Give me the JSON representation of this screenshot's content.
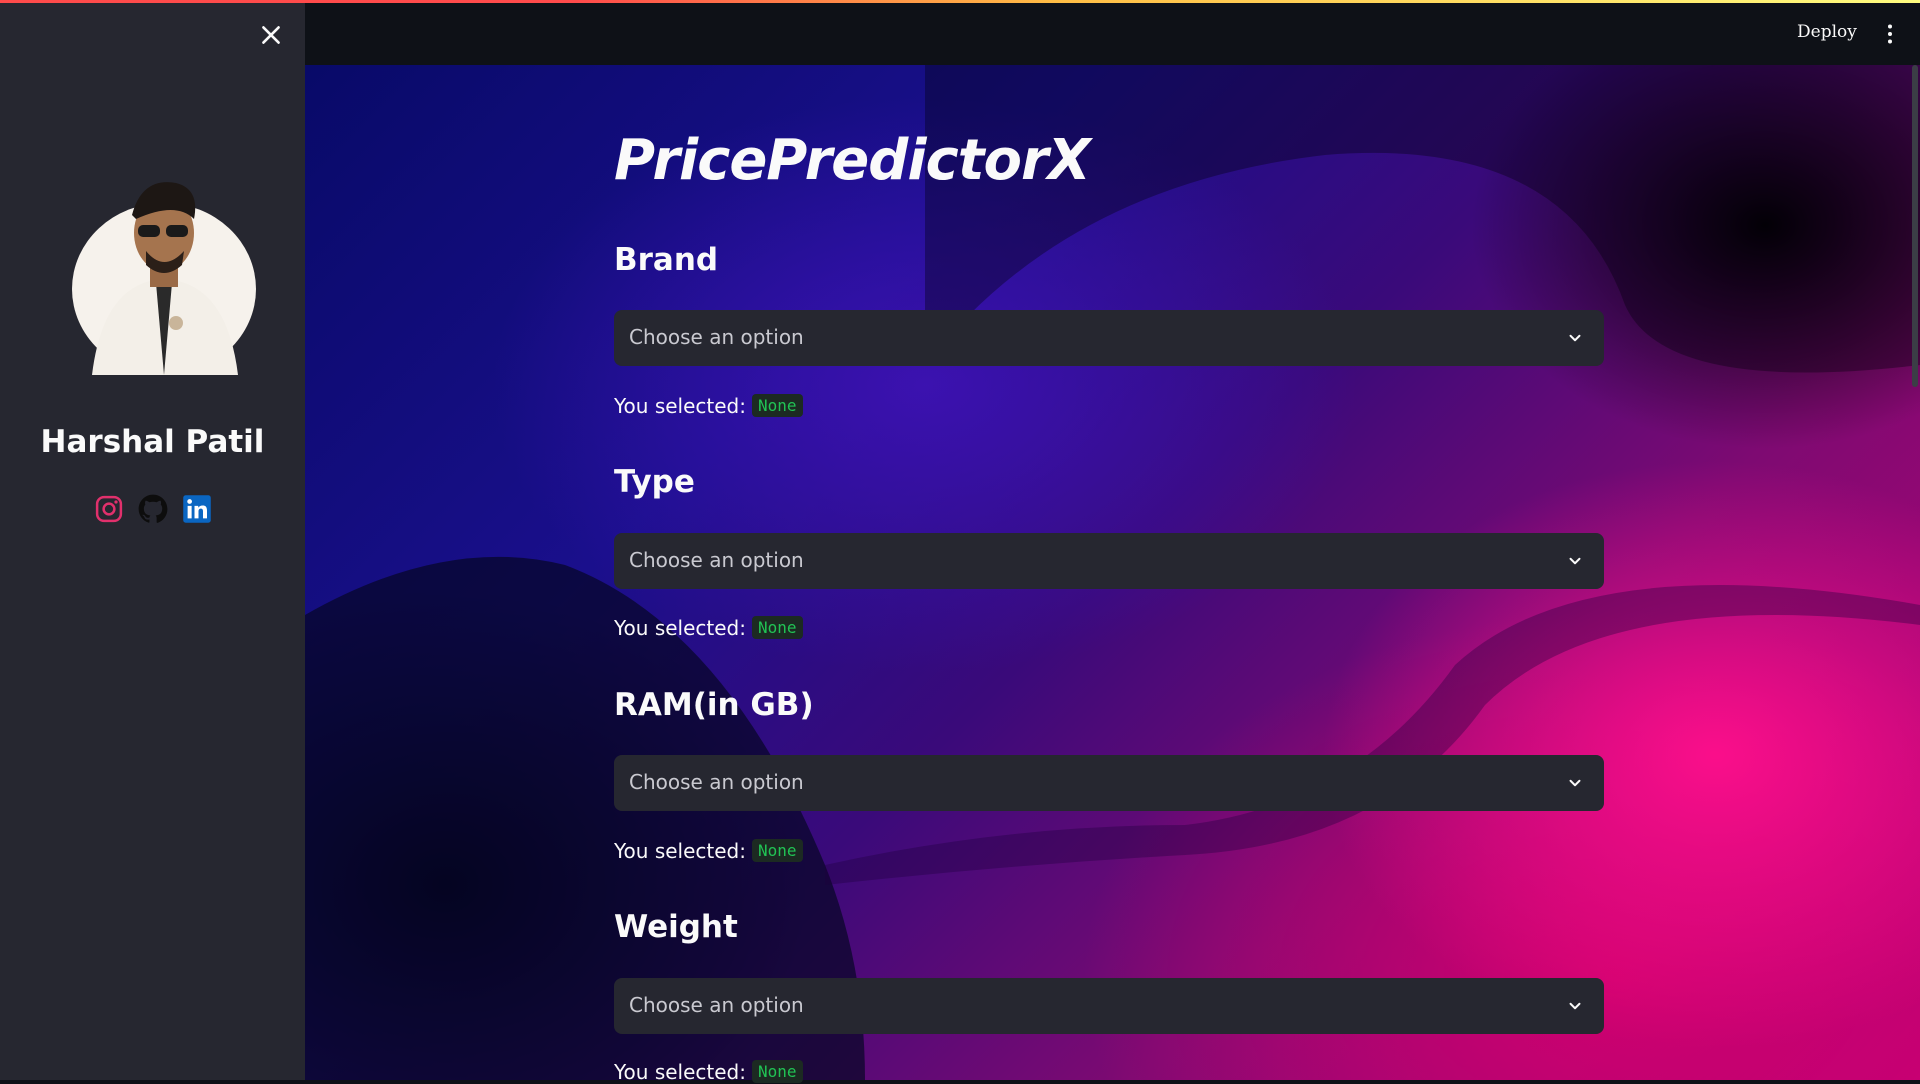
{
  "sidebar": {
    "name": "Harshal Patil",
    "social_icons": [
      "instagram-icon",
      "github-icon",
      "linkedin-icon"
    ]
  },
  "header": {
    "deploy_label": "Deploy"
  },
  "main": {
    "title": "PricePredictorX",
    "selected_prefix": "You selected:",
    "fields": [
      {
        "label": "Brand",
        "placeholder": "Choose an option",
        "selected": "None"
      },
      {
        "label": "Type",
        "placeholder": "Choose an option",
        "selected": "None"
      },
      {
        "label": "RAM(in GB)",
        "placeholder": "Choose an option",
        "selected": "None"
      },
      {
        "label": "Weight",
        "placeholder": "Choose an option",
        "selected": "None"
      }
    ]
  },
  "colors": {
    "sidebar_bg": "#262730",
    "select_bg": "#262730",
    "badge_text": "#21c354",
    "instagram": "#e1306c",
    "linkedin": "#0a66c2"
  }
}
